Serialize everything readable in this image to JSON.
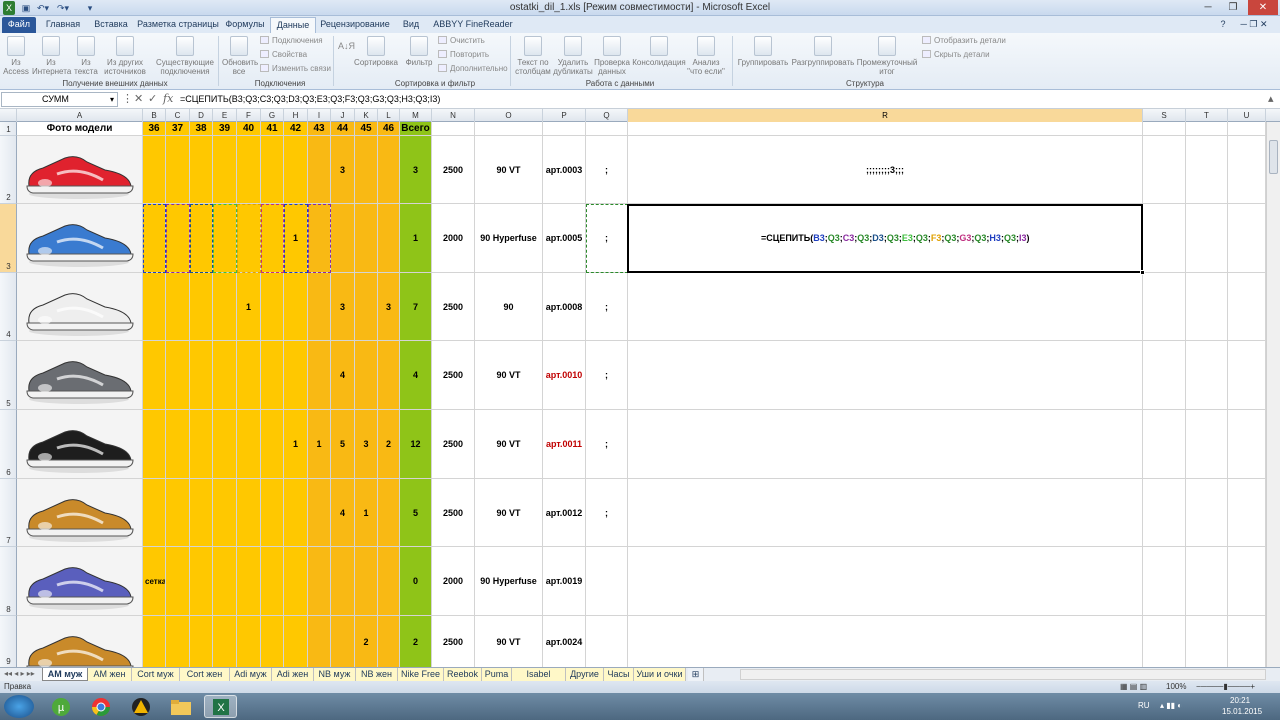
{
  "window": {
    "title": "ostatki_dil_1.xls  [Режим совместимости]  -  Microsoft Excel"
  },
  "tabs": [
    "Файл",
    "Главная",
    "Вставка",
    "Разметка страницы",
    "Формулы",
    "Данные",
    "Рецензирование",
    "Вид",
    "ABBYY FineReader 11"
  ],
  "ribbon": {
    "ext": {
      "access": "Из Access",
      "web": "Из Интернета",
      "text": "Из текста",
      "other": "Из других источников",
      "existing": "Существующие подключения",
      "label": "Получение внешних данных"
    },
    "conn": {
      "refresh": "Обновить все",
      "connections": "Подключения",
      "props": "Свойства",
      "edit": "Изменить связи",
      "label": "Подключения"
    },
    "sort": {
      "az": "А↓Я",
      "sort": "Сортировка",
      "filter": "Фильтр",
      "clear": "Очистить",
      "reapply": "Повторить",
      "advanced": "Дополнительно",
      "label": "Сортировка и фильтр"
    },
    "tools": {
      "t2c": "Текст по столбцам",
      "dup": "Удалить дубликаты",
      "valid": "Проверка данных",
      "consol": "Консолидация",
      "whatif": "Анализ \"что если\"",
      "label": "Работа с данными"
    },
    "struct": {
      "group": "Группировать",
      "ungroup": "Разгруппировать",
      "subtotal": "Промежуточный итог",
      "show": "Отобразить детали",
      "hide": "Скрыть детали",
      "label": "Структура"
    }
  },
  "formula_bar": {
    "name_box": "СУММ",
    "formula": "=СЦЕПИТЬ(B3;Q3;C3;Q3;D3;Q3;E3;Q3;F3;Q3;G3;Q3;H3;Q3;I3)"
  },
  "columns": [
    "A",
    "B",
    "C",
    "D",
    "E",
    "F",
    "G",
    "H",
    "I",
    "J",
    "K",
    "L",
    "M",
    "N",
    "O",
    "P",
    "Q",
    "R",
    "S",
    "T",
    "U"
  ],
  "header_row": {
    "photo": "Фото модели",
    "sizes": [
      "36",
      "37",
      "38",
      "39",
      "40",
      "41",
      "42",
      "43",
      "44",
      "45",
      "46"
    ],
    "total": "Всего"
  },
  "rows": [
    {
      "num": "2",
      "sizes": [
        "",
        "",
        "",
        "",
        "",
        "",
        "",
        "",
        "3",
        "",
        ""
      ],
      "total": "3",
      "price": "2500",
      "model": "90 VT",
      "art": "арт.0003",
      "art_red": false,
      "q": ";",
      "r": ";;;;;;;;3;;;"
    },
    {
      "num": "3",
      "sizes": [
        "",
        "",
        "",
        "",
        "",
        "",
        "1",
        "",
        "",
        "",
        ""
      ],
      "total": "1",
      "price": "2000",
      "model": "90 Hyperfuse",
      "art": "арт.0005",
      "art_red": false,
      "q": ";",
      "r": ""
    },
    {
      "num": "4",
      "sizes": [
        "",
        "",
        "",
        "",
        "1",
        "",
        "",
        "",
        "3",
        "",
        "3"
      ],
      "total": "7",
      "price": "2500",
      "model": "90",
      "art": "арт.0008",
      "art_red": false,
      "q": ";",
      "r": ""
    },
    {
      "num": "5",
      "sizes": [
        "",
        "",
        "",
        "",
        "",
        "",
        "",
        "",
        "4",
        "",
        ""
      ],
      "total": "4",
      "price": "2500",
      "model": "90 VT",
      "art": "арт.0010",
      "art_red": true,
      "q": ";",
      "r": ""
    },
    {
      "num": "6",
      "sizes": [
        "",
        "",
        "",
        "",
        "",
        "",
        "1",
        "1",
        "5",
        "3",
        "2"
      ],
      "total": "12",
      "price": "2500",
      "model": "90 VT",
      "art": "арт.0011",
      "art_red": true,
      "q": ";",
      "r": ""
    },
    {
      "num": "7",
      "sizes": [
        "",
        "",
        "",
        "",
        "",
        "",
        "",
        "",
        "4",
        "1",
        ""
      ],
      "total": "5",
      "price": "2500",
      "model": "90 VT",
      "art": "арт.0012",
      "art_red": false,
      "q": ";",
      "r": ""
    },
    {
      "num": "8",
      "sizes": [
        "сетка",
        "",
        "",
        "",
        "",
        "",
        "",
        "",
        "",
        "",
        ""
      ],
      "total": "0",
      "price": "2000",
      "model": "90 Hyperfuse",
      "art": "арт.0019",
      "art_red": false,
      "q": "",
      "r": ""
    },
    {
      "num": "9",
      "sizes": [
        "",
        "",
        "",
        "",
        "",
        "",
        "",
        "",
        "",
        "2",
        ""
      ],
      "total": "2",
      "price": "2500",
      "model": "90 VT",
      "art": "арт.0024",
      "art_red": false,
      "q": "",
      "r": ""
    }
  ],
  "shoe_colors": [
    "#e0222e",
    "#3a7bd0",
    "#eeeeee",
    "#6a6d72",
    "#1e1e1e",
    "#c98a2a",
    "#5a5fbd",
    "#c98a2a"
  ],
  "edit_parts": [
    {
      "t": "=СЦЕПИТЬ(",
      "c": "#000000"
    },
    {
      "t": "B3",
      "c": "#1f3fc0"
    },
    {
      "t": ";",
      "c": "#000000"
    },
    {
      "t": "Q3",
      "c": "#2a8a2a"
    },
    {
      "t": ";",
      "c": "#000000"
    },
    {
      "t": "C3",
      "c": "#8a2aa0"
    },
    {
      "t": ";",
      "c": "#000000"
    },
    {
      "t": "Q3",
      "c": "#2a8a2a"
    },
    {
      "t": ";",
      "c": "#000000"
    },
    {
      "t": "D3",
      "c": "#1a4f8a"
    },
    {
      "t": ";",
      "c": "#000000"
    },
    {
      "t": "Q3",
      "c": "#2a8a2a"
    },
    {
      "t": ";",
      "c": "#000000"
    },
    {
      "t": "E3",
      "c": "#3fbf3f"
    },
    {
      "t": ";",
      "c": "#000000"
    },
    {
      "t": "Q3",
      "c": "#2a8a2a"
    },
    {
      "t": ";",
      "c": "#000000"
    },
    {
      "t": "F3",
      "c": "#e0a000"
    },
    {
      "t": ";",
      "c": "#000000"
    },
    {
      "t": "Q3",
      "c": "#2a8a2a"
    },
    {
      "t": ";",
      "c": "#000000"
    },
    {
      "t": "G3",
      "c": "#c03080"
    },
    {
      "t": ";",
      "c": "#000000"
    },
    {
      "t": "Q3",
      "c": "#2a8a2a"
    },
    {
      "t": ";",
      "c": "#000000"
    },
    {
      "t": "H3",
      "c": "#1f3fc0"
    },
    {
      "t": ";",
      "c": "#000000"
    },
    {
      "t": "Q3",
      "c": "#2a8a2a"
    },
    {
      "t": ";",
      "c": "#000000"
    },
    {
      "t": "I3",
      "c": "#8a2aa0"
    },
    {
      "t": ")",
      "c": "#000000"
    }
  ],
  "sheets": [
    "AM муж",
    "AM жен",
    "Cort муж",
    "Cort жен",
    "Adi муж",
    "Adi жен",
    "NB муж",
    "NB жен",
    "Nike Free",
    "Reebok",
    "Puma",
    "Isabel Marant",
    "Другие",
    "Часы",
    "Уши и очки"
  ],
  "status": {
    "mode": "Правка",
    "zoom": "100%"
  },
  "tray": {
    "lang": "RU",
    "time": "20:21",
    "date": "15.01.2015"
  }
}
